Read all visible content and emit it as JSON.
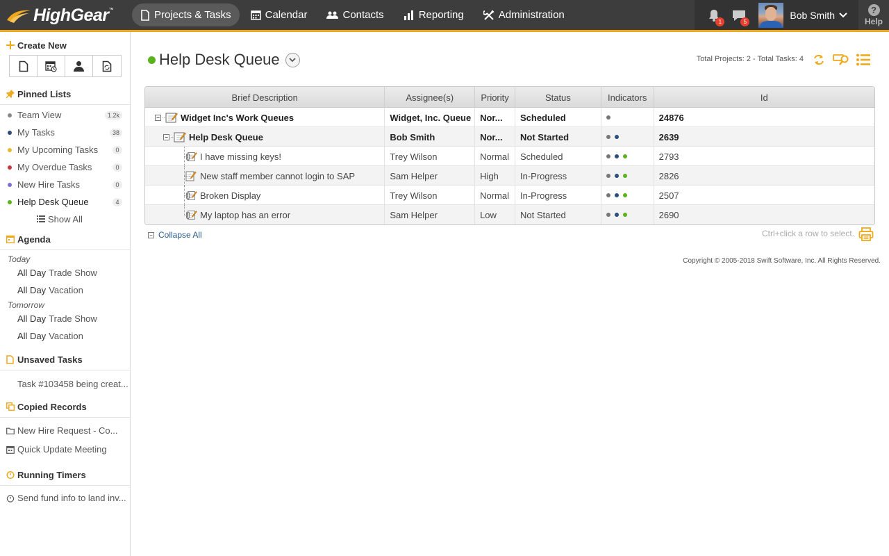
{
  "app": {
    "brand": "HighGear",
    "tm": "™"
  },
  "nav": [
    {
      "label": "Projects & Tasks",
      "icon": "document-icon",
      "active": true
    },
    {
      "label": "Calendar",
      "icon": "calendar-icon",
      "active": false
    },
    {
      "label": "Contacts",
      "icon": "contacts-icon",
      "active": false
    },
    {
      "label": "Reporting",
      "icon": "bar-chart-icon",
      "active": false
    },
    {
      "label": "Administration",
      "icon": "tools-icon",
      "active": false
    }
  ],
  "top_right": {
    "notifications_count": "1",
    "messages_count": "5",
    "user_name": "Bob Smith",
    "help_label": "Help"
  },
  "sidebar": {
    "create_new": {
      "title": "Create New"
    },
    "pinned": {
      "title": "Pinned Lists",
      "items": [
        {
          "label": "Team View",
          "count": "1.2k",
          "color": "#8a8a8a"
        },
        {
          "label": "My Tasks",
          "count": "38",
          "color": "#2d4d7c"
        },
        {
          "label": "My Upcoming Tasks",
          "count": "0",
          "color": "#e7b92c"
        },
        {
          "label": "My Overdue Tasks",
          "count": "0",
          "color": "#c9373a"
        },
        {
          "label": "New Hire Tasks",
          "count": "0",
          "color": "#7b6fd6"
        },
        {
          "label": "Help Desk Queue",
          "count": "4",
          "color": "#5ab31c"
        }
      ],
      "show_all": "Show All"
    },
    "agenda": {
      "title": "Agenda",
      "days": [
        {
          "label": "Today",
          "items": [
            {
              "when": "All Day",
              "what": "Trade Show"
            },
            {
              "when": "All Day",
              "what": "Vacation"
            }
          ]
        },
        {
          "label": "Tomorrow",
          "items": [
            {
              "when": "All Day",
              "what": "Trade Show"
            },
            {
              "when": "All Day",
              "what": "Vacation"
            }
          ]
        }
      ]
    },
    "unsaved": {
      "title": "Unsaved Tasks",
      "items": [
        "Task #103458 being creat..."
      ]
    },
    "copied": {
      "title": "Copied Records",
      "items": [
        "New Hire Request - Co...",
        "Quick Update Meeting"
      ]
    },
    "timers": {
      "title": "Running Timers",
      "items": [
        "Send fund info to land inv..."
      ]
    }
  },
  "main": {
    "title": "Help Desk Queue",
    "totals": "Total Projects: 2 - Total Tasks: 4",
    "columns": [
      "Brief Description",
      "Assignee(s)",
      "Priority",
      "Status",
      "Indicators",
      "Id"
    ],
    "rows": [
      {
        "desc": "Widget Inc's Work Queues",
        "assignee": "Widget, Inc. Queue",
        "priority": "Nor...",
        "status": "Scheduled",
        "indicators": [
          "#777777"
        ],
        "id": "24876",
        "level": 0,
        "type": "project",
        "bold": true
      },
      {
        "desc": "Help Desk Queue",
        "assignee": "Bob Smith",
        "priority": "Nor...",
        "status": "Not Started",
        "indicators": [
          "#777777",
          "#2d4d7c"
        ],
        "id": "2639",
        "level": 1,
        "type": "project",
        "bold": true
      },
      {
        "desc": "I have missing keys!",
        "assignee": "Trey Wilson",
        "priority": "Normal",
        "status": "Scheduled",
        "indicators": [
          "#777777",
          "#2d4d7c",
          "#5ab31c"
        ],
        "id": "2793",
        "level": 2,
        "type": "task-attach",
        "bold": false
      },
      {
        "desc": "New staff member cannot login to SAP",
        "assignee": "Sam Helper",
        "priority": "High",
        "status": "In-Progress",
        "indicators": [
          "#777777",
          "#2d4d7c",
          "#5ab31c"
        ],
        "id": "2826",
        "level": 2,
        "type": "task",
        "bold": false
      },
      {
        "desc": "Broken Display",
        "assignee": "Trey Wilson",
        "priority": "Normal",
        "status": "In-Progress",
        "indicators": [
          "#777777",
          "#2d4d7c",
          "#5ab31c"
        ],
        "id": "2507",
        "level": 2,
        "type": "task-attach",
        "bold": false
      },
      {
        "desc": "My laptop has an error",
        "assignee": "Sam Helper",
        "priority": "Low",
        "status": "Not Started",
        "indicators": [
          "#777777",
          "#2d4d7c",
          "#5ab31c"
        ],
        "id": "2690",
        "level": 2,
        "type": "task-attach",
        "bold": false
      }
    ],
    "collapse_all": "Collapse All",
    "ctrl_hint": "Ctrl+click a row to select.",
    "copyright": "Copyright © 2005-2018 Swift Software, Inc. All Rights Reserved."
  },
  "colors": {
    "accent": "#f0a91c",
    "topbar": "#3d3d3d",
    "status_green": "#5ab31c"
  }
}
